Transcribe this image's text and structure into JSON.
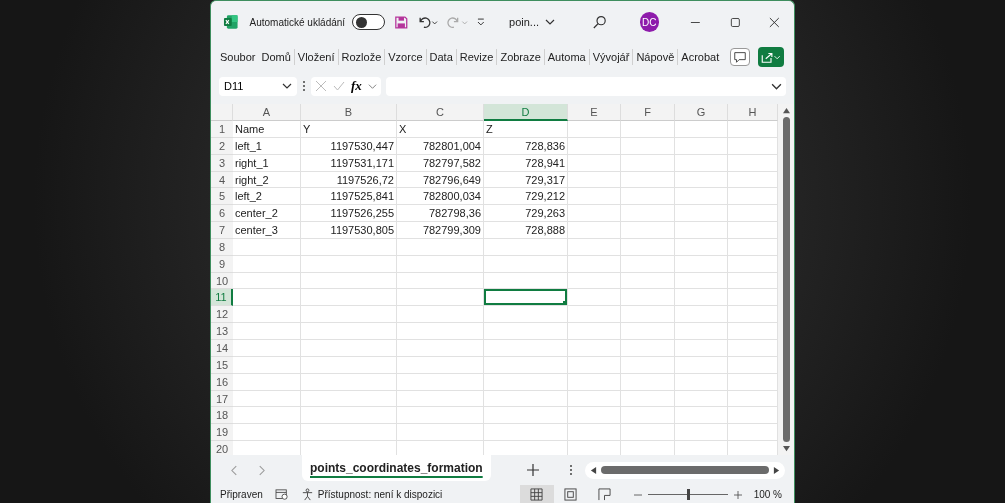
{
  "title_bar": {
    "autosave_label": "Automatické ukládání",
    "autosave_on": false,
    "file_name": "poin...",
    "avatar": "DC"
  },
  "ribbon_tabs": [
    "Soubor",
    "Domů",
    "Vložení",
    "Rozlože",
    "Vzorce",
    "Data",
    "Revize",
    "Zobraze",
    "Automa",
    "Vývojář",
    "Nápově",
    "Acrobat"
  ],
  "formula_bar": {
    "name_box": "D11",
    "fx": "fx"
  },
  "columns": [
    {
      "label": "A",
      "kind": "text",
      "selected": false
    },
    {
      "label": "B",
      "kind": "number",
      "selected": false
    },
    {
      "label": "C",
      "kind": "number",
      "selected": false
    },
    {
      "label": "D",
      "kind": "number",
      "selected": true
    },
    {
      "label": "E",
      "kind": "text",
      "selected": false
    },
    {
      "label": "F",
      "kind": "text",
      "selected": false
    },
    {
      "label": "G",
      "kind": "text",
      "selected": false
    },
    {
      "label": "H",
      "kind": "text",
      "selected": false
    }
  ],
  "rows": [
    {
      "number": "1",
      "kind": "header",
      "selected": false,
      "cells": [
        "Name",
        "Y",
        "X",
        "Z"
      ]
    },
    {
      "number": "2",
      "kind": "data",
      "selected": false,
      "cells": [
        "left_1",
        "1197530,447",
        "782801,004",
        "728,836"
      ]
    },
    {
      "number": "3",
      "kind": "data",
      "selected": false,
      "cells": [
        "right_1",
        "1197531,171",
        "782797,582",
        "728,941"
      ]
    },
    {
      "number": "4",
      "kind": "data",
      "selected": false,
      "cells": [
        "right_2",
        "1197526,72",
        "782796,649",
        "729,317"
      ]
    },
    {
      "number": "5",
      "kind": "data",
      "selected": false,
      "cells": [
        "left_2",
        "1197525,841",
        "782800,034",
        "729,212"
      ]
    },
    {
      "number": "6",
      "kind": "data",
      "selected": false,
      "cells": [
        "center_2",
        "1197526,255",
        "782798,36",
        "729,263"
      ]
    },
    {
      "number": "7",
      "kind": "data",
      "selected": false,
      "cells": [
        "center_3",
        "1197530,805",
        "782799,309",
        "728,888"
      ]
    },
    {
      "number": "8",
      "kind": "data",
      "selected": false,
      "cells": []
    },
    {
      "number": "9",
      "kind": "data",
      "selected": false,
      "cells": []
    },
    {
      "number": "10",
      "kind": "data",
      "selected": false,
      "cells": []
    },
    {
      "number": "11",
      "kind": "data",
      "selected": true,
      "cells": []
    },
    {
      "number": "12",
      "kind": "data",
      "selected": false,
      "cells": []
    },
    {
      "number": "13",
      "kind": "data",
      "selected": false,
      "cells": []
    },
    {
      "number": "14",
      "kind": "data",
      "selected": false,
      "cells": []
    },
    {
      "number": "15",
      "kind": "data",
      "selected": false,
      "cells": []
    },
    {
      "number": "16",
      "kind": "data",
      "selected": false,
      "cells": []
    },
    {
      "number": "17",
      "kind": "data",
      "selected": false,
      "cells": []
    },
    {
      "number": "18",
      "kind": "data",
      "selected": false,
      "cells": []
    },
    {
      "number": "19",
      "kind": "data",
      "selected": false,
      "cells": []
    },
    {
      "number": "20",
      "kind": "data",
      "selected": false,
      "cells": []
    }
  ],
  "sheet_tabs": [
    {
      "label": "points_coordinates_formation",
      "selected": true
    }
  ],
  "status_bar": {
    "ready": "Připraven",
    "accessibility": "Přístupnost: není k dispozici",
    "views": [
      {
        "kind": "normal",
        "selected": true
      },
      {
        "kind": "layout",
        "selected": false
      },
      {
        "kind": "break",
        "selected": false
      }
    ],
    "zoom_slider": {
      "level": 0.5
    },
    "zoom": "100 %"
  }
}
